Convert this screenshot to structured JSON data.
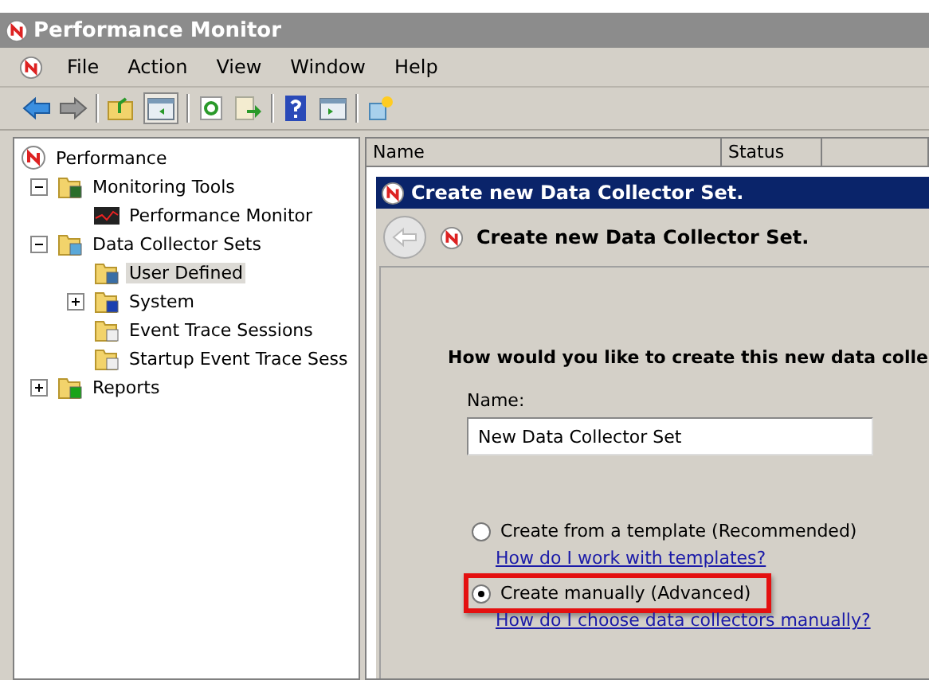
{
  "window": {
    "title": "Performance Monitor"
  },
  "menu": [
    "File",
    "Action",
    "View",
    "Window",
    "Help"
  ],
  "tree": [
    {
      "label": "Performance",
      "kind": "performance",
      "selected": false,
      "children": [
        {
          "label": "Monitoring Tools",
          "kind": "monitoring",
          "selected": false,
          "expanded": true,
          "children": [
            {
              "label": "Performance Monitor",
              "kind": "graph",
              "selected": false
            }
          ]
        },
        {
          "label": "Data Collector Sets",
          "kind": "collector",
          "selected": false,
          "expanded": true,
          "children": [
            {
              "label": "User Defined",
              "kind": "user",
              "selected": true
            },
            {
              "label": "System",
              "kind": "system",
              "selected": false,
              "expanded": false
            },
            {
              "label": "Event Trace Sessions",
              "kind": "trace",
              "selected": false
            },
            {
              "label": "Startup Event Trace Sess",
              "kind": "trace",
              "selected": false
            }
          ]
        },
        {
          "label": "Reports",
          "kind": "report",
          "selected": false,
          "expanded": false
        }
      ]
    }
  ],
  "columns": [
    "Name",
    "Status"
  ],
  "dialog": {
    "title": "Create new Data Collector Set.",
    "heading": "Create new Data Collector Set.",
    "question": "How would you like to create this new data colle",
    "name_label": "Name:",
    "name_value": "New Data Collector Set",
    "options": [
      {
        "label": "Create from a template (Recommended)",
        "link": "How do I work with templates?",
        "selected": false,
        "highlighted": false
      },
      {
        "label": "Create manually (Advanced)",
        "link": "How do I choose data collectors manually?",
        "selected": true,
        "highlighted": true
      }
    ]
  }
}
